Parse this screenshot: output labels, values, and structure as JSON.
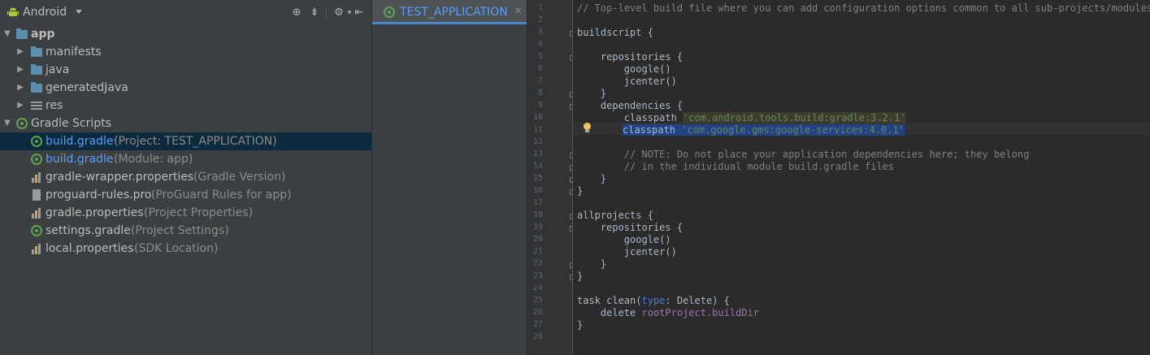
{
  "project_view": {
    "title": "Android",
    "tree": [
      {
        "label": "app",
        "hint": "",
        "icon": "module-icon",
        "arrow": "down"
      },
      {
        "label": "manifests",
        "hint": "",
        "icon": "folder-icon",
        "arrow": "right"
      },
      {
        "label": "java",
        "hint": "",
        "icon": "folder-icon",
        "arrow": "right"
      },
      {
        "label": "generatedJava",
        "hint": "",
        "icon": "generated-folder-icon",
        "arrow": "right"
      },
      {
        "label": "res",
        "hint": "",
        "icon": "res-folder-icon",
        "arrow": "right"
      },
      {
        "label": "Gradle Scripts",
        "hint": "",
        "icon": "gradle-icon",
        "arrow": "down"
      },
      {
        "label": "build.gradle",
        "hint": " (Project: TEST_APPLICATION)",
        "icon": "gradle-icon",
        "arrow": ""
      },
      {
        "label": "build.gradle",
        "hint": " (Module: app)",
        "icon": "gradle-icon",
        "arrow": ""
      },
      {
        "label": "gradle-wrapper.properties",
        "hint": " (Gradle Version)",
        "icon": "properties-icon",
        "arrow": ""
      },
      {
        "label": "proguard-rules.pro",
        "hint": " (ProGuard Rules for app)",
        "icon": "file-icon",
        "arrow": ""
      },
      {
        "label": "gradle.properties",
        "hint": " (Project Properties)",
        "icon": "properties-icon",
        "arrow": ""
      },
      {
        "label": "settings.gradle",
        "hint": " (Project Settings)",
        "icon": "gradle-icon",
        "arrow": ""
      },
      {
        "label": "local.properties",
        "hint": " (SDK Location)",
        "icon": "properties-icon",
        "arrow": ""
      }
    ]
  },
  "editor": {
    "tab_title": "TEST_APPLICATION",
    "tab_close": "×",
    "line_numbers": [
      "1",
      "2",
      "3",
      "4",
      "5",
      "6",
      "7",
      "8",
      "9",
      "10",
      "11",
      "12",
      "13",
      "14",
      "15",
      "16",
      "17",
      "18",
      "19",
      "20",
      "21",
      "22",
      "23",
      "24",
      "25",
      "26",
      "27",
      "28"
    ],
    "code": {
      "l1": "// Top-level build file where you can add configuration options common to all sub-projects/modules.",
      "l3": "buildscript {",
      "l5": "    repositories {",
      "l6": "        google()",
      "l7": "        jcenter()",
      "l8": "    }",
      "l9": "    dependencies {",
      "l10_kw": "        classpath ",
      "l10_str": "'com.android.tools.build:gradle:3.2.1'",
      "l11_kw": "classpath ",
      "l11_str": "'com.google.gms:google-services:4.0.1'",
      "l13": "        // NOTE: Do not place your application dependencies here; they belong",
      "l14": "        // in the individual module build.gradle files",
      "l15": "    }",
      "l16": "}",
      "l18": "allprojects {",
      "l19": "    repositories {",
      "l20": "        google()",
      "l21": "        jcenter()",
      "l22": "    }",
      "l23": "}",
      "l25_a": "task clean(",
      "l25_b": "type",
      "l25_c": ": Delete) {",
      "l26_a": "    delete ",
      "l26_b": "rootProject.buildDir",
      "l27": "}"
    }
  }
}
